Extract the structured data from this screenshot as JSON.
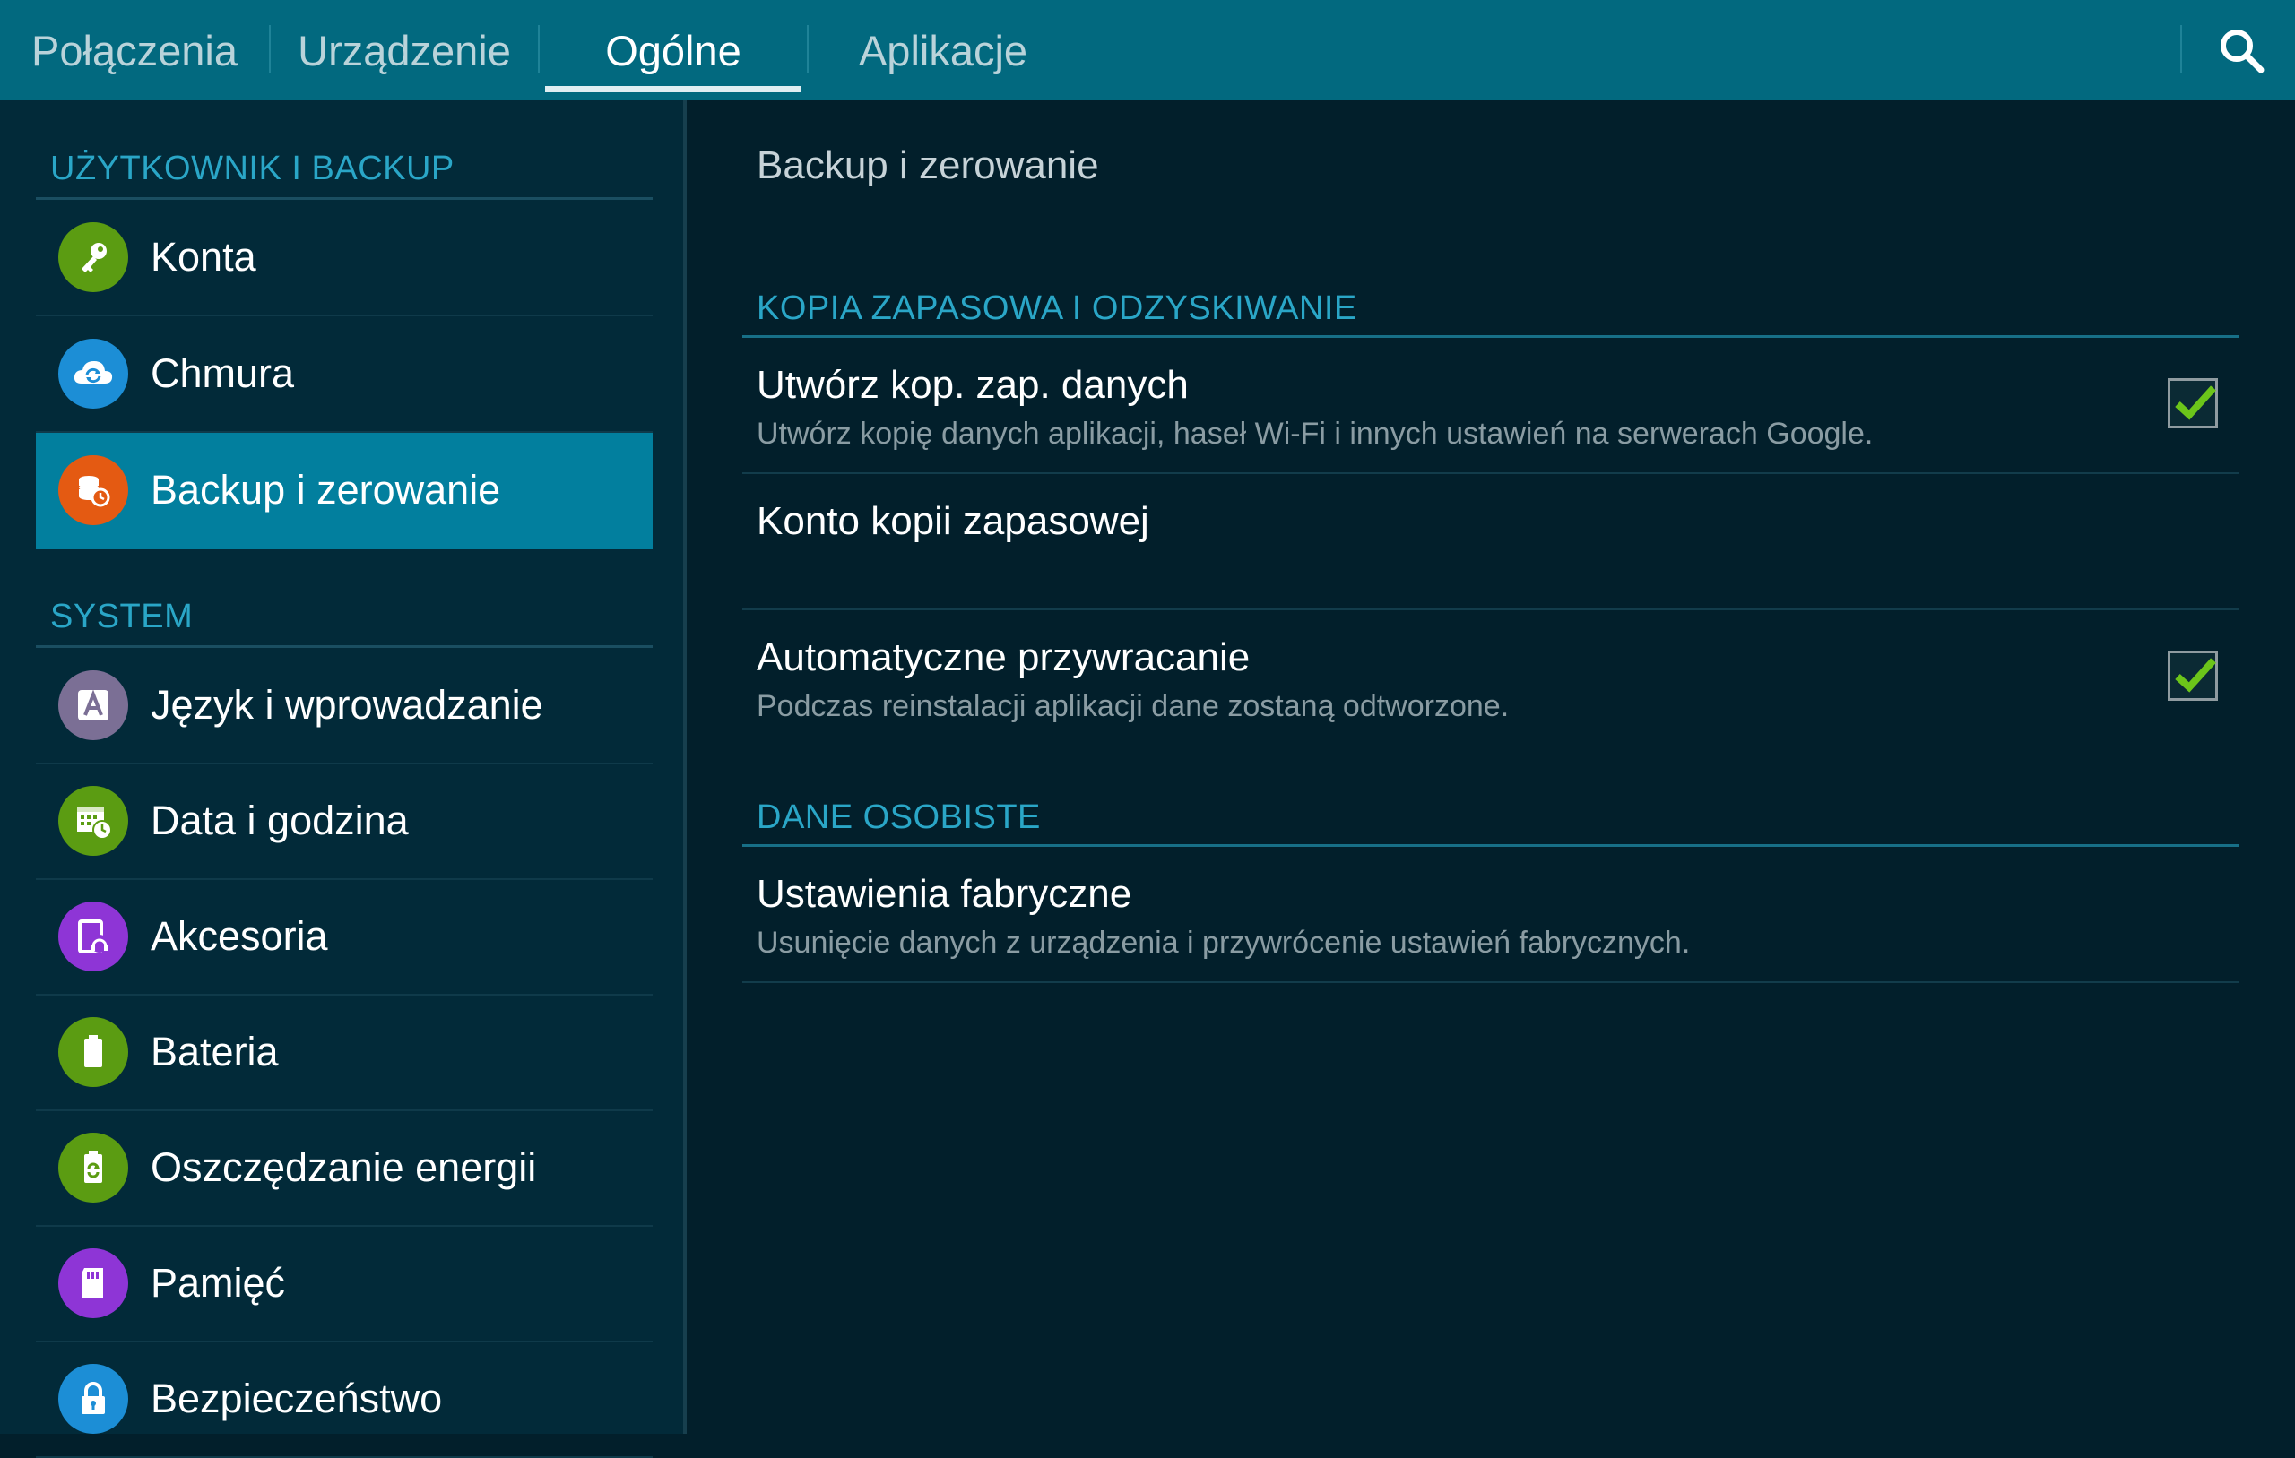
{
  "tabs": [
    {
      "label": "Połączenia",
      "active": false
    },
    {
      "label": "Urządzenie",
      "active": false
    },
    {
      "label": "Ogólne",
      "active": true
    },
    {
      "label": "Aplikacje",
      "active": false
    }
  ],
  "search": {
    "icon": "search-icon"
  },
  "sidebar": {
    "sections": [
      {
        "header": "UŻYTKOWNIK I BACKUP",
        "items": [
          {
            "label": "Konta",
            "icon": "key-icon",
            "color": "#5b9c12"
          },
          {
            "label": "Chmura",
            "icon": "cloud-sync-icon",
            "color": "#1c8ed6"
          },
          {
            "label": "Backup i zerowanie",
            "icon": "backup-icon",
            "color": "#e45a12",
            "selected": true
          }
        ]
      },
      {
        "header": "SYSTEM",
        "items": [
          {
            "label": "Język i wprowadzanie",
            "icon": "language-icon",
            "color": "#7b6f95"
          },
          {
            "label": "Data i godzina",
            "icon": "calendar-clock-icon",
            "color": "#5b9c12"
          },
          {
            "label": "Akcesoria",
            "icon": "accessory-icon",
            "color": "#8e35d6"
          },
          {
            "label": "Bateria",
            "icon": "battery-icon",
            "color": "#5b9c12"
          },
          {
            "label": "Oszczędzanie energii",
            "icon": "power-saving-icon",
            "color": "#5b9c12"
          },
          {
            "label": "Pamięć",
            "icon": "sd-card-icon",
            "color": "#8e35d6"
          },
          {
            "label": "Bezpieczeństwo",
            "icon": "lock-icon",
            "color": "#1c8ed6"
          }
        ]
      }
    ]
  },
  "content": {
    "title": "Backup i zerowanie",
    "sections": [
      {
        "header": "KOPIA ZAPASOWA I ODZYSKIWANIE",
        "items": [
          {
            "title": "Utwórz kop. zap. danych",
            "subtitle": "Utwórz kopię danych aplikacji, haseł Wi-Fi i innych ustawień na serwerach Google.",
            "checked": true
          },
          {
            "title": "Konto kopii zapasowej",
            "subtitle": ""
          },
          {
            "title": "Automatyczne przywracanie",
            "subtitle": "Podczas reinstalacji aplikacji dane zostaną odtworzone.",
            "checked": true
          }
        ]
      },
      {
        "header": "DANE OSOBISTE",
        "items": [
          {
            "title": "Ustawienia fabryczne",
            "subtitle": "Usunięcie danych z urządzenia i przywrócenie ustawień fabrycznych."
          }
        ]
      }
    ]
  },
  "colors": {
    "topbar": "#02697f",
    "accent": "#2aa6c7",
    "selected": "#027f9e",
    "check": "#6cc51a"
  }
}
